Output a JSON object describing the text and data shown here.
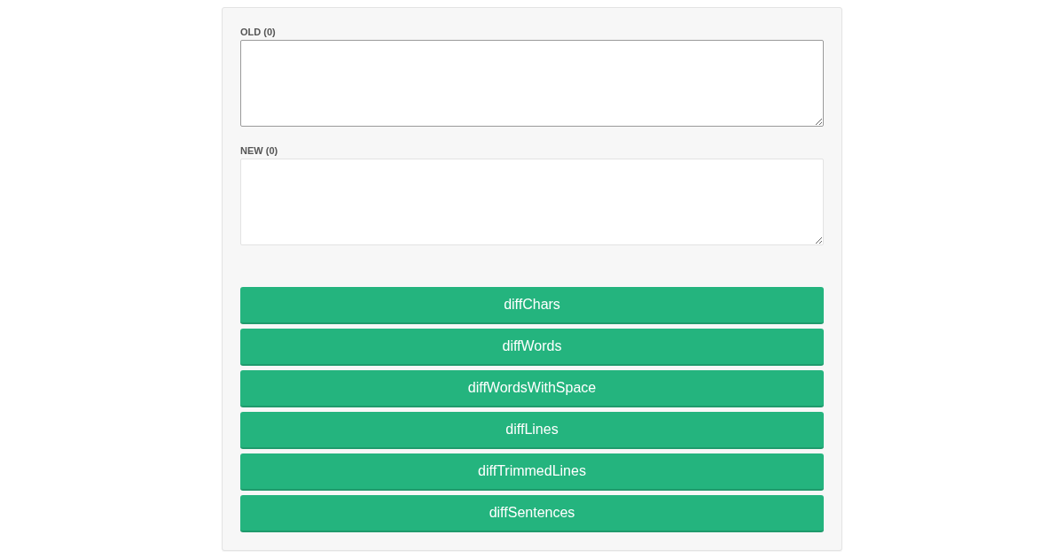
{
  "fields": [
    {
      "label": "OLD (0)",
      "focused": true
    },
    {
      "label": "NEW (0)",
      "focused": false
    }
  ],
  "buttons": [
    "diffChars",
    "diffWords",
    "diffWordsWithSpace",
    "diffLines",
    "diffTrimmedLines",
    "diffSentences"
  ]
}
